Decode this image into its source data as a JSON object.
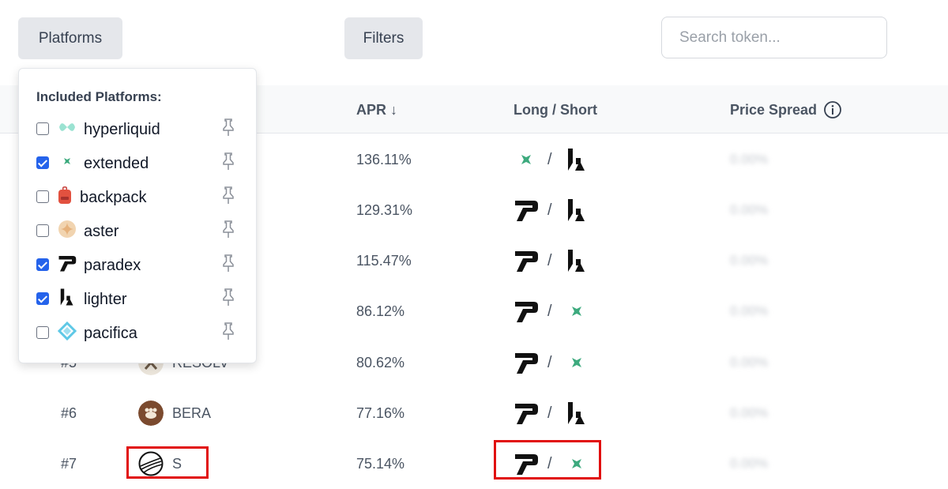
{
  "toolbar": {
    "platforms_label": "Platforms",
    "filters_label": "Filters",
    "search_placeholder": "Search token..."
  },
  "table": {
    "columns": [
      "APR ↓",
      "Long / Short",
      "Price Spread"
    ],
    "rows": [
      {
        "apr": "136.11%",
        "long": "extended",
        "short": "lighter",
        "spread": "0.00%"
      },
      {
        "apr": "129.31%",
        "long": "paradex",
        "short": "lighter",
        "spread": "0.00%"
      },
      {
        "apr": "115.47%",
        "long": "paradex",
        "short": "lighter",
        "spread": "0.00%"
      },
      {
        "apr": "86.12%",
        "long": "paradex",
        "short": "extended",
        "spread": "0.00%"
      },
      {
        "rank": "#5",
        "token": "RESOLV",
        "apr": "80.62%",
        "long": "paradex",
        "short": "extended",
        "spread": "0.00%"
      },
      {
        "rank": "#6",
        "token": "BERA",
        "apr": "77.16%",
        "long": "paradex",
        "short": "lighter",
        "spread": "0.00%"
      },
      {
        "rank": "#7",
        "token": "S",
        "apr": "75.14%",
        "long": "paradex",
        "short": "extended",
        "spread": "0.00%"
      }
    ]
  },
  "dropdown": {
    "title": "Included Platforms:",
    "platforms": [
      {
        "name": "hyperliquid",
        "checked": false,
        "icon": "hyperliquid-icon"
      },
      {
        "name": "extended",
        "checked": true,
        "icon": "extended-icon"
      },
      {
        "name": "backpack",
        "checked": false,
        "icon": "backpack-icon"
      },
      {
        "name": "aster",
        "checked": false,
        "icon": "aster-icon"
      },
      {
        "name": "paradex",
        "checked": true,
        "icon": "paradex-icon"
      },
      {
        "name": "lighter",
        "checked": true,
        "icon": "lighter-icon"
      },
      {
        "name": "pacifica",
        "checked": false,
        "icon": "pacifica-icon"
      }
    ]
  },
  "colors": {
    "highlight": "#e10f0f",
    "checkbox_on": "#2563eb",
    "extended_green": "#3daa7e"
  }
}
